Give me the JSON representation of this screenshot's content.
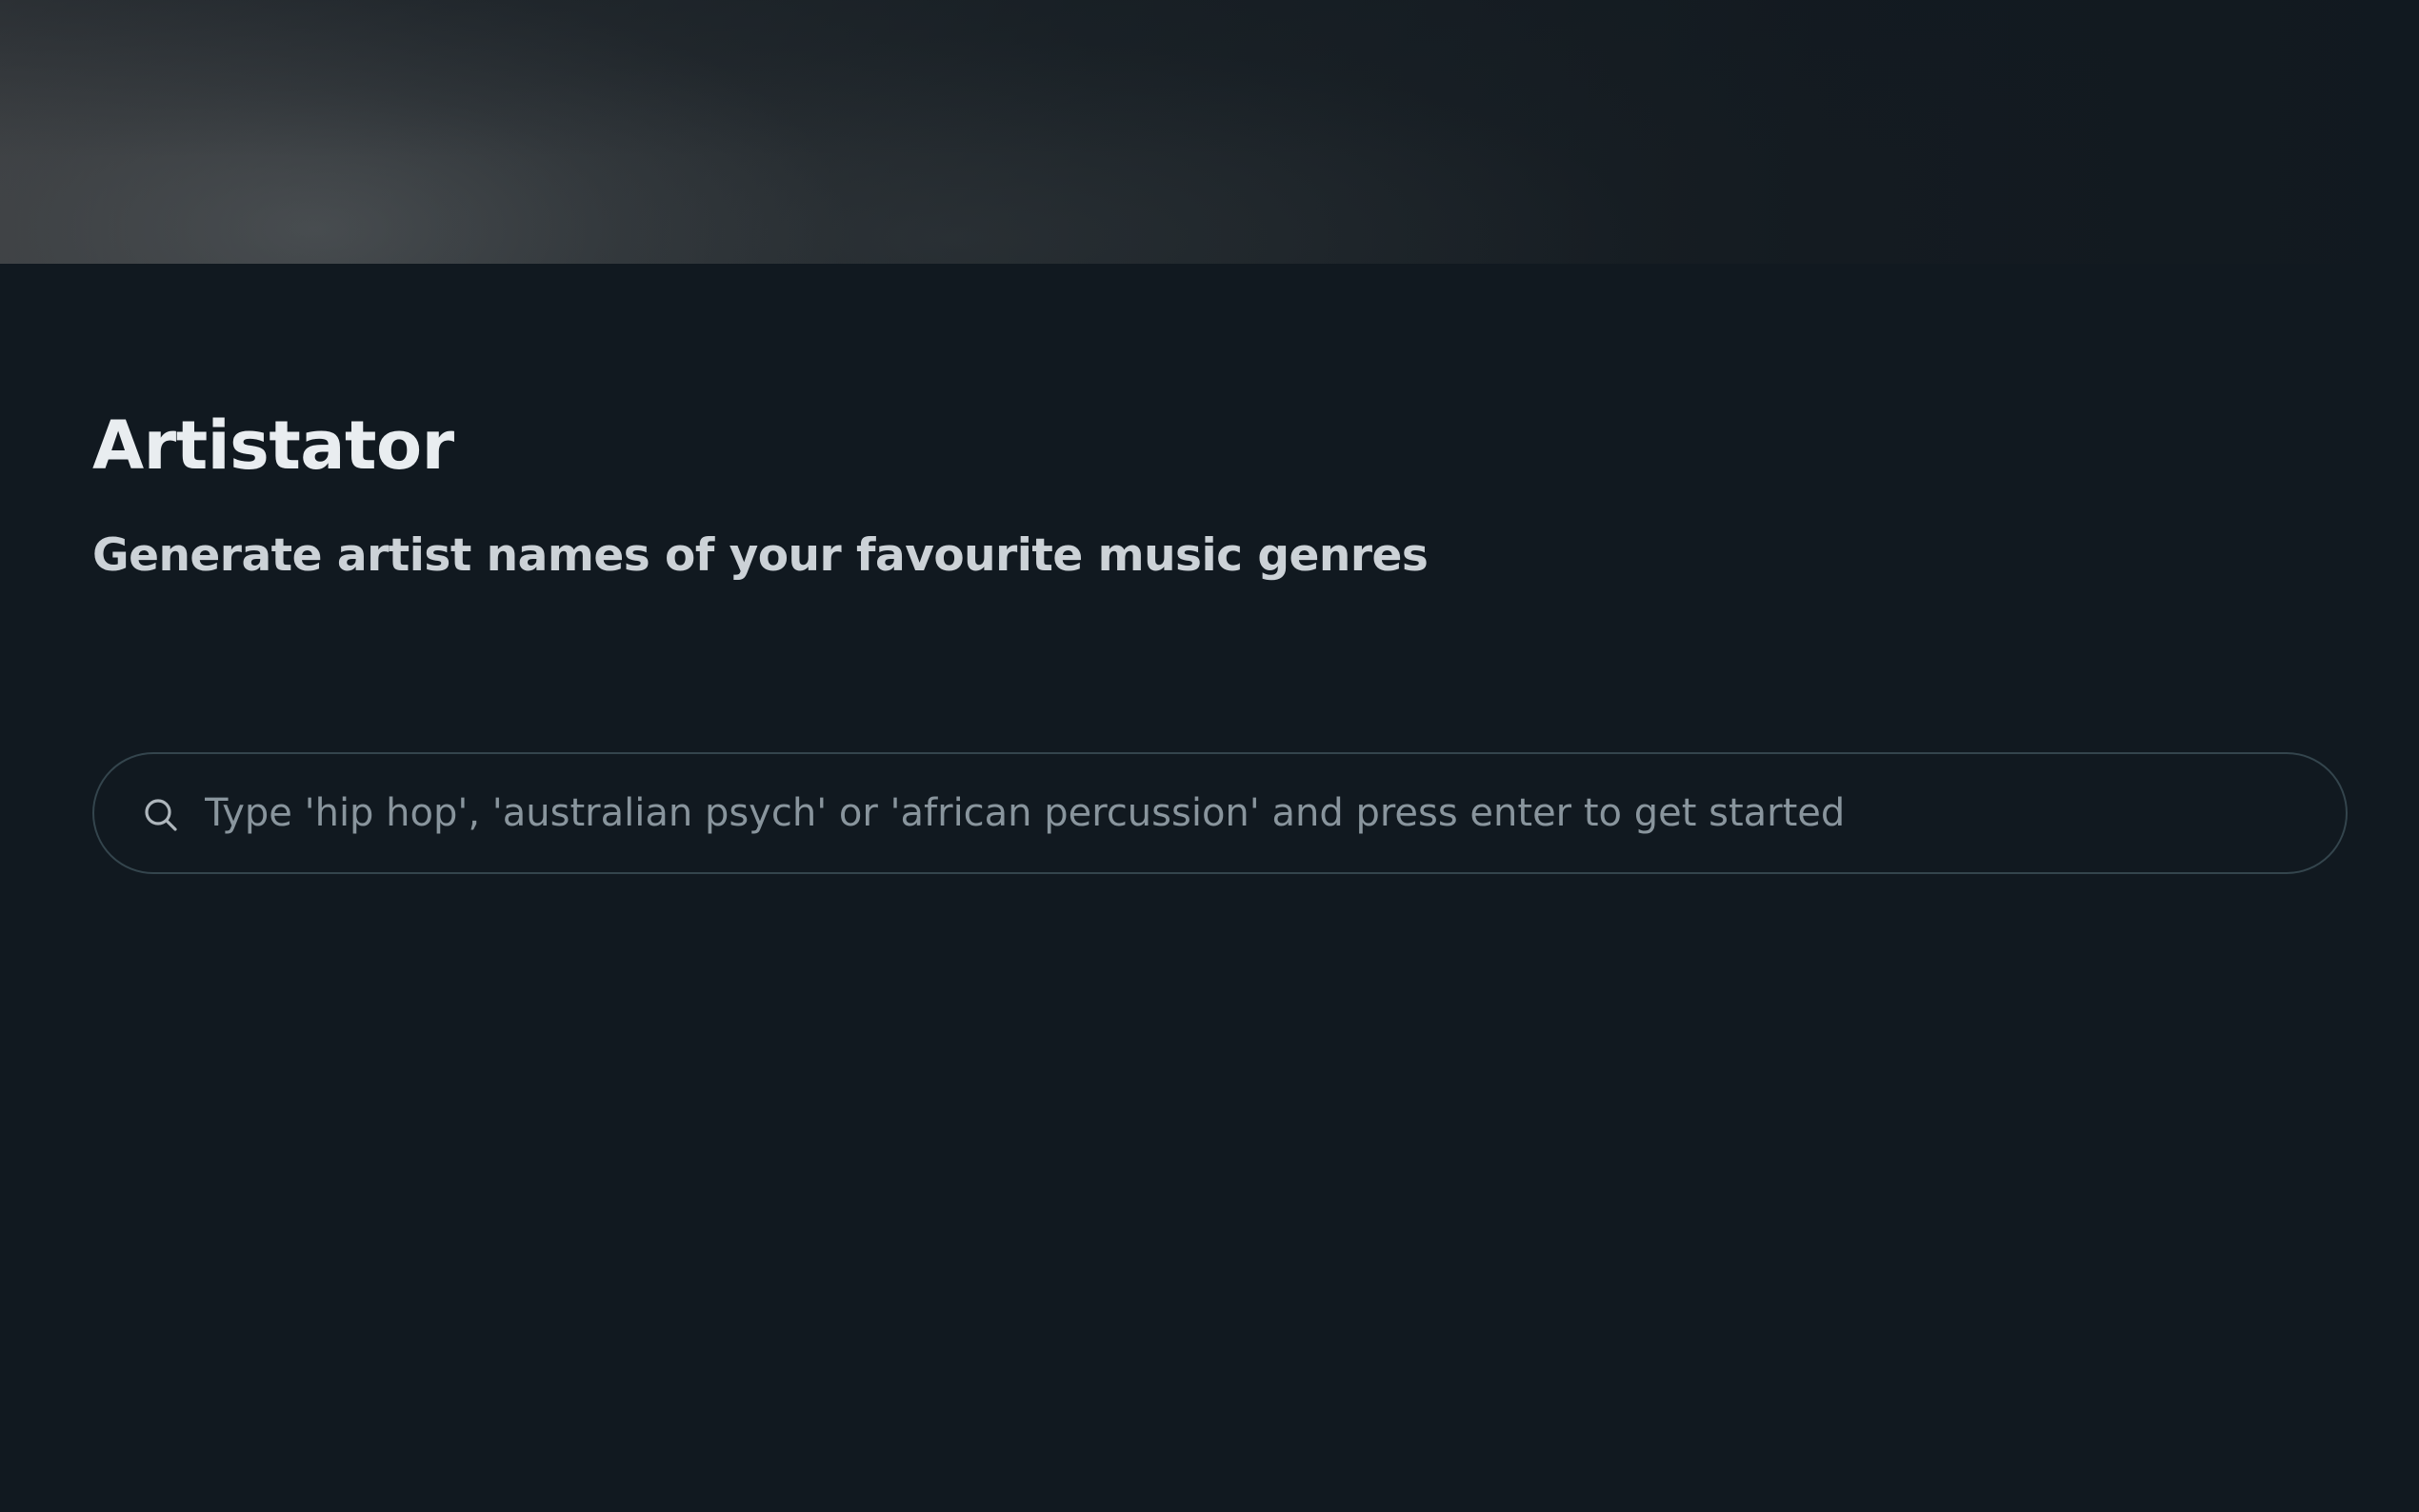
{
  "app": {
    "title": "Artistator",
    "subtitle": "Generate artist names of your favourite music genres"
  },
  "search": {
    "icon": "search-icon",
    "placeholder": "Type 'hip hop', 'australian psych' or 'african percussion' and press enter to get started",
    "value": ""
  },
  "colors": {
    "background": "#111920",
    "title": "#e9edf0",
    "subtitle": "#ccd2d7",
    "search_border": "#34454d",
    "placeholder": "#89959d"
  }
}
